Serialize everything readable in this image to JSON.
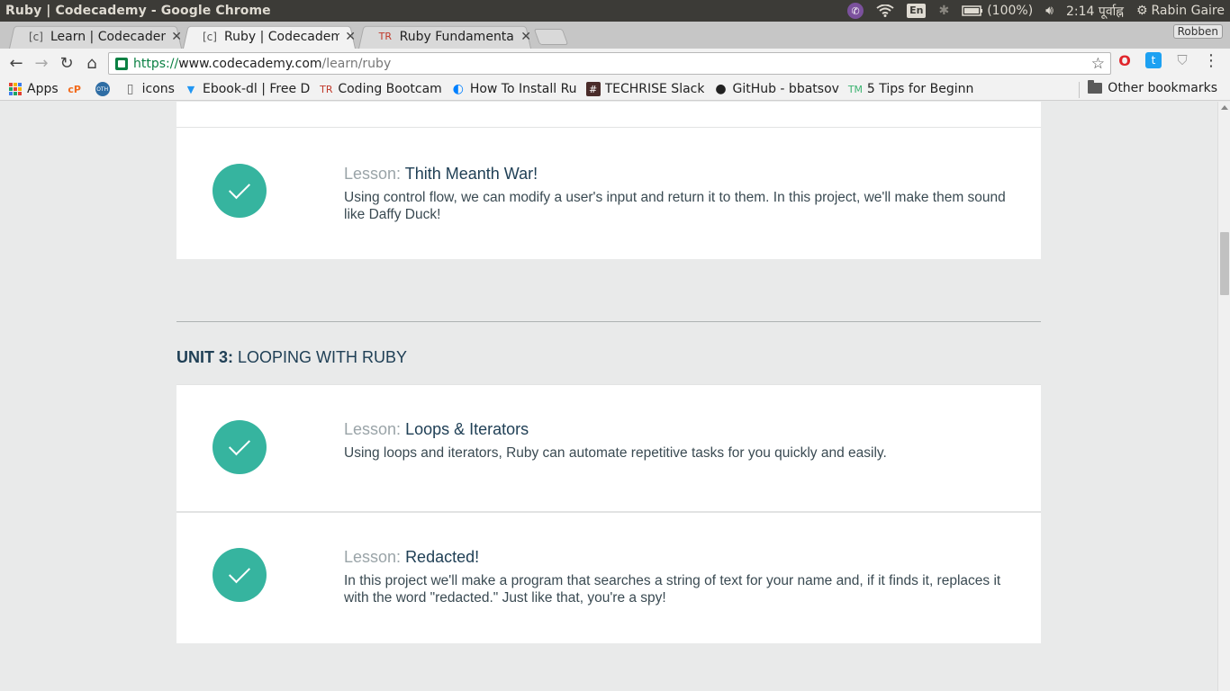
{
  "os_bar": {
    "title": "Ruby | Codecademy - Google Chrome",
    "lang": "En",
    "battery": "(100%)",
    "time": "2:14 पूर्वाह्न",
    "user": "Rabin Gaire"
  },
  "tabs": [
    {
      "label": "Learn | Codecademy",
      "favicon": "C"
    },
    {
      "label": "Ruby | Codecademy",
      "favicon": "C"
    },
    {
      "label": "Ruby Fundamentals",
      "favicon": "TR"
    }
  ],
  "profile": "Robben",
  "omnibox": {
    "scheme": "https://",
    "host": "www.codecademy.com",
    "path": "/learn/ruby"
  },
  "bookmarks": [
    {
      "label": "Apps",
      "icon": "apps-grid-icon"
    },
    {
      "label": "",
      "icon": "cpanel-icon",
      "glyph": "cP"
    },
    {
      "label": "",
      "icon": "oth-icon",
      "glyph": "OTH"
    },
    {
      "label": "icons",
      "icon": "page-icon",
      "glyph": "▯"
    },
    {
      "label": "Ebook-dl | Free D",
      "icon": "ebook-icon",
      "glyph": "▼"
    },
    {
      "label": "Coding Bootcam",
      "icon": "techrise-icon",
      "glyph": "TR"
    },
    {
      "label": "How To Install Ru",
      "icon": "digitalocean-icon",
      "glyph": "◐"
    },
    {
      "label": "TECHRISE Slack",
      "icon": "slack-icon",
      "glyph": "#"
    },
    {
      "label": "GitHub - bbatsov",
      "icon": "github-icon",
      "glyph": "●"
    },
    {
      "label": "5 Tips for Beginn",
      "icon": "tm-icon",
      "glyph": "TM"
    }
  ],
  "other_bookmarks": "Other bookmarks",
  "content": {
    "card_top": {
      "prefix": "Lesson:",
      "title": "Thith Meanth War!",
      "desc": "Using control flow, we can modify a user's input and return it to them. In this project, we'll make them sound like Daffy Duck!"
    },
    "unit3": {
      "num": "UNIT 3:",
      "name": "LOOPING WITH RUBY"
    },
    "lessons": [
      {
        "prefix": "Lesson:",
        "title": "Loops & Iterators",
        "desc": "Using loops and iterators, Ruby can automate repetitive tasks for you quickly and easily."
      },
      {
        "prefix": "Lesson:",
        "title": "Redacted!",
        "desc": "In this project we'll make a program that searches a string of text for your name and, if it finds it, replaces it with the word \"redacted.\" Just like that, you're a spy!"
      }
    ]
  },
  "colors": {
    "check": "#36b49f",
    "title": "#204056",
    "background": "#e9eaea"
  }
}
